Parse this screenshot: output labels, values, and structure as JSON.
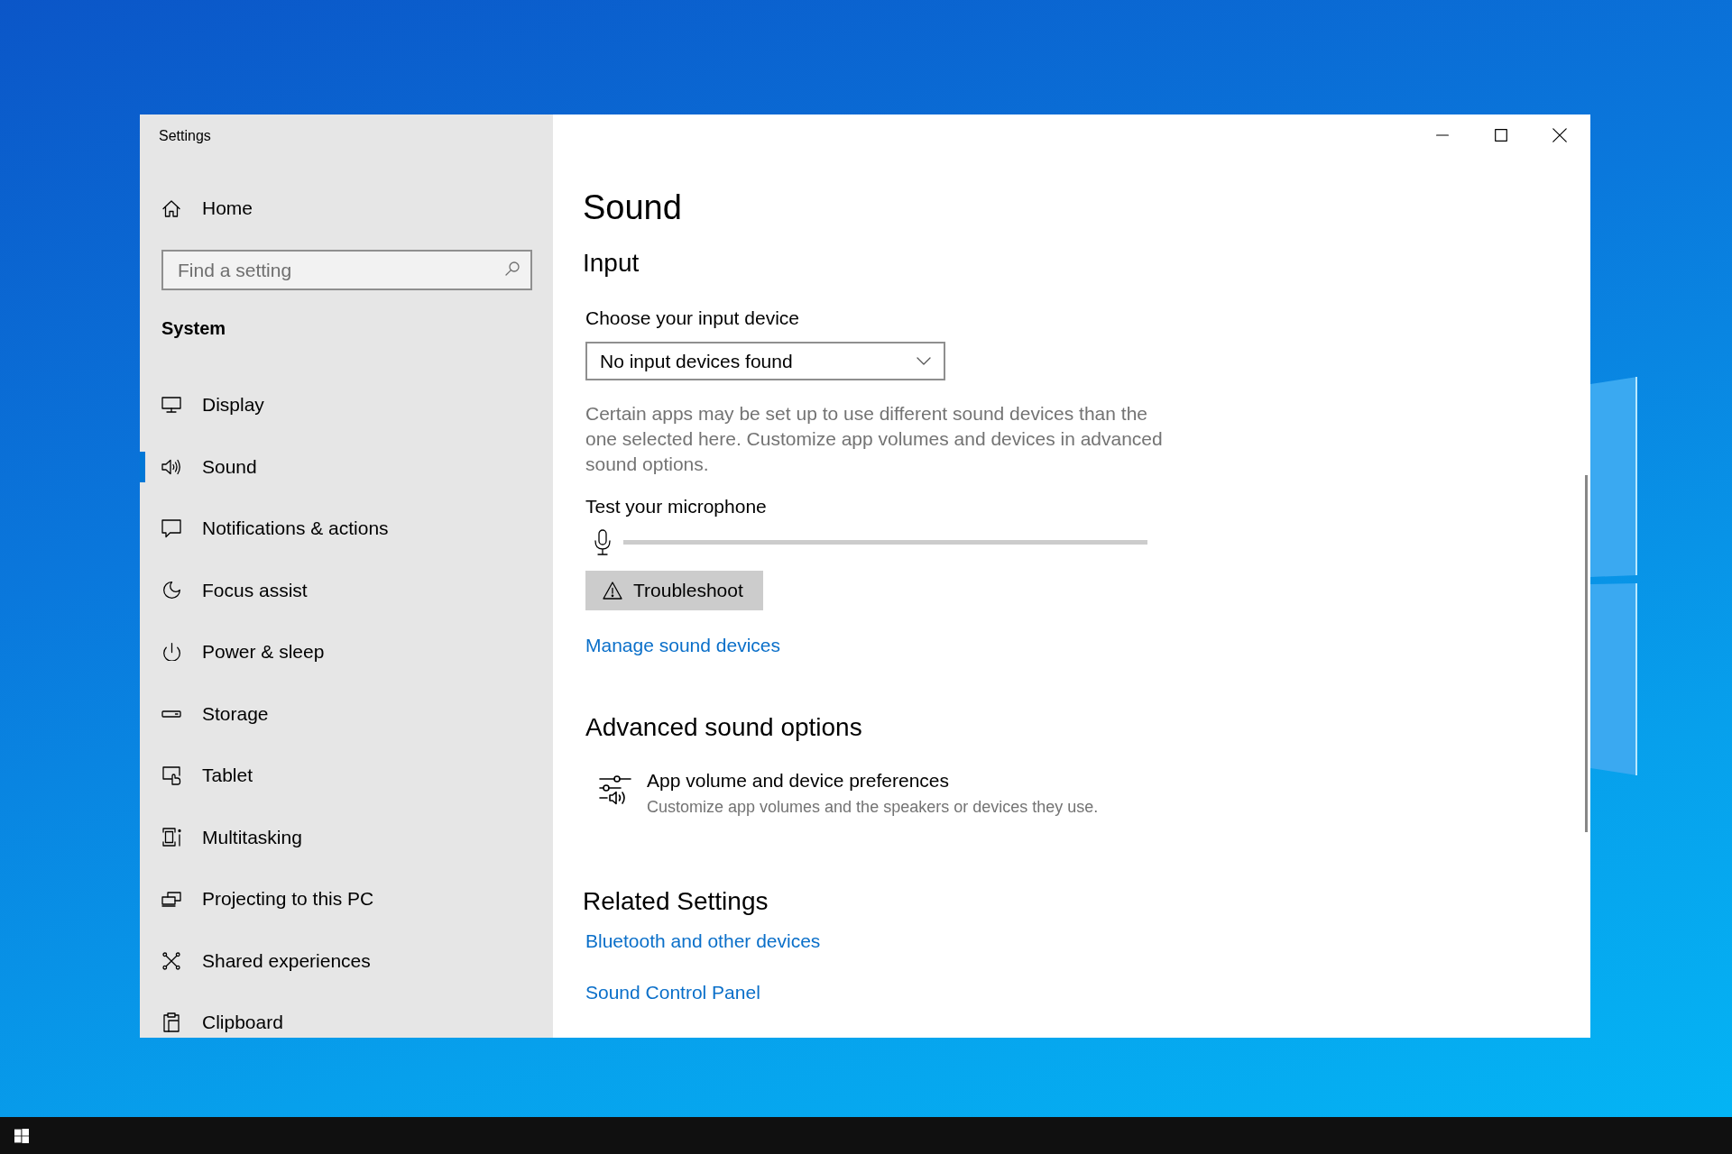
{
  "window": {
    "title": "Settings"
  },
  "sidebar": {
    "home": "Home",
    "search": {
      "placeholder": "Find a setting"
    },
    "section": "System",
    "items": [
      {
        "label": "Display",
        "selected": false
      },
      {
        "label": "Sound",
        "selected": true
      },
      {
        "label": "Notifications & actions",
        "selected": false
      },
      {
        "label": "Focus assist",
        "selected": false
      },
      {
        "label": "Power & sleep",
        "selected": false
      },
      {
        "label": "Storage",
        "selected": false
      },
      {
        "label": "Tablet",
        "selected": false
      },
      {
        "label": "Multitasking",
        "selected": false
      },
      {
        "label": "Projecting to this PC",
        "selected": false
      },
      {
        "label": "Shared experiences",
        "selected": false
      },
      {
        "label": "Clipboard",
        "selected": false
      }
    ]
  },
  "page": {
    "title": "Sound",
    "input": {
      "heading": "Input",
      "device_label": "Choose your input device",
      "device_dropdown": {
        "value": "No input devices found"
      },
      "description": "Certain apps may be set up to use different sound devices than the one selected here. Customize app volumes and devices in advanced sound options.",
      "test_label": "Test your microphone",
      "troubleshoot_button": "Troubleshoot",
      "manage_link": "Manage sound devices"
    },
    "advanced": {
      "heading": "Advanced sound options",
      "items": [
        {
          "title": "App volume and device preferences",
          "subtitle": "Customize app volumes and the speakers or devices they use."
        }
      ]
    },
    "related": {
      "heading": "Related Settings",
      "links": [
        "Bluetooth and other devices",
        "Sound Control Panel"
      ]
    }
  }
}
